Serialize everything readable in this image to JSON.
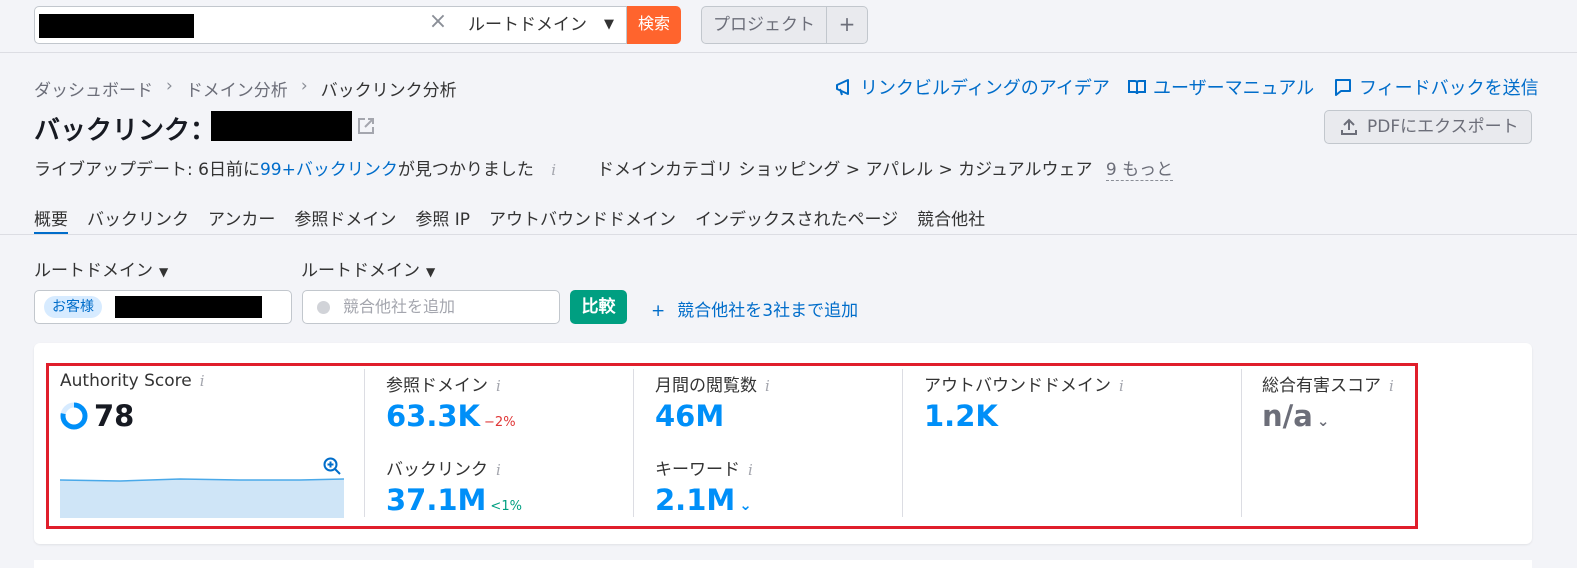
{
  "search": {
    "clear_icon": "close-icon",
    "scope": "ルートドメイン",
    "button": "検索"
  },
  "projects": {
    "label": "プロジェクト",
    "add": "+"
  },
  "breadcrumb": [
    "ダッシュボード",
    "ドメイン分析",
    "バックリンク分析"
  ],
  "header_links": {
    "ideas": "リンクビルディングのアイデア",
    "manual": "ユーザーマニュアル",
    "feedback": "フィードバックを送信"
  },
  "title": "バックリンク：",
  "export_pdf": "PDFにエクスポート",
  "live_update": {
    "prefix": "ライブアップデート: 6日前に",
    "link": "99+バックリンク",
    "suffix": "が見つかりました"
  },
  "domain_category": {
    "text": "ドメインカテゴリ ショッピング > アパレル > カジュアルウェア",
    "more": "9 もっと"
  },
  "tabs": [
    "概要",
    "バックリンク",
    "アンカー",
    "参照ドメイン",
    "参照 IP",
    "アウトバウンドドメイン",
    "インデックスされたページ",
    "競合他社"
  ],
  "filters": {
    "scope_left": "ルートドメイン",
    "scope_right": "ルートドメイン",
    "you_tag": "お客様",
    "competitor_placeholder": "競合他社を追加",
    "compare_button": "比較",
    "add_competitors": "競合他社を3社まで追加"
  },
  "metrics": {
    "authority": {
      "label": "Authority Score",
      "value": "78",
      "score_fraction": 0.78
    },
    "ref_domains": {
      "label": "参照ドメイン",
      "value": "63.3K",
      "delta": "−2%"
    },
    "backlinks": {
      "label": "バックリンク",
      "value": "37.1M",
      "delta": "<1%"
    },
    "monthly_visits": {
      "label": "月間の閲覧数",
      "value": "46M"
    },
    "keywords": {
      "label": "キーワード",
      "value": "2.1M"
    },
    "outbound": {
      "label": "アウトバウンドドメイン",
      "value": "1.2K"
    },
    "toxic": {
      "label": "総合有害スコア",
      "value": "n/a"
    }
  },
  "colors": {
    "accent_blue": "#006dca",
    "metric_blue": "#008ff8",
    "search_orange": "#ff642d",
    "compare_green": "#009f81",
    "highlight_red": "#e01e2b",
    "negative_red": "#e03636"
  },
  "info_icon": "i"
}
